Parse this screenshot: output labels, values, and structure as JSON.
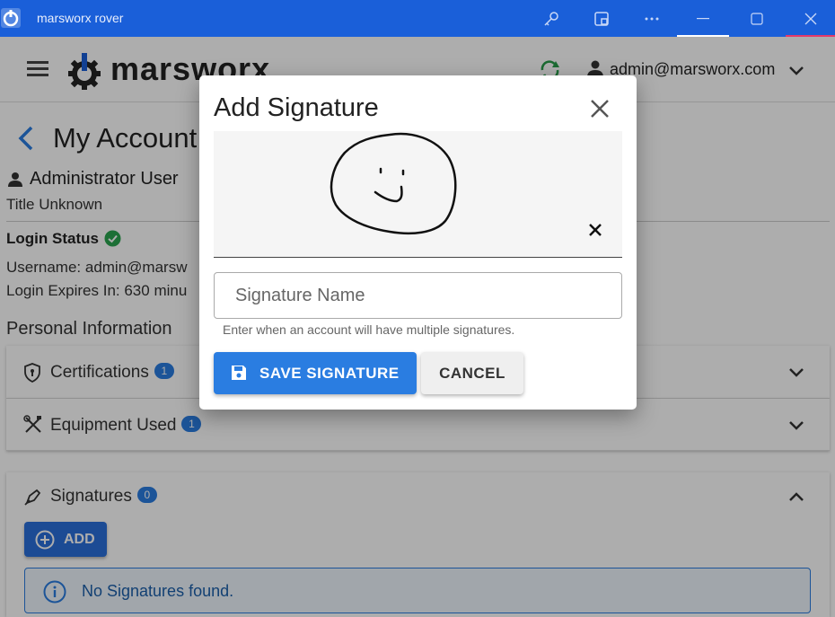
{
  "window": {
    "title": "marsworx rover",
    "accent_color": "#1a5fd9"
  },
  "appbar": {
    "brand": "marsworx",
    "user_email": "admin@marsworx.com"
  },
  "account": {
    "page_title": "My Account",
    "user_name": "Administrator User",
    "user_title": "Title Unknown",
    "login_status_label": "Login Status",
    "username_line": "Username: admin@marsw",
    "expires_line": "Login Expires In: 630 minu",
    "personal_heading": "Personal Information"
  },
  "panels": {
    "certifications": {
      "label": "Certifications",
      "count": "1"
    },
    "equipment": {
      "label": "Equipment Used",
      "count": "1"
    },
    "signatures": {
      "label": "Signatures",
      "count": "0"
    }
  },
  "signatures_section": {
    "add_label": "ADD",
    "empty_message": "No Signatures found."
  },
  "dialog": {
    "title": "Add Signature",
    "name_placeholder": "Signature Name",
    "name_value": "",
    "hint": "Enter when an account will have multiple signatures.",
    "save_label": "SAVE SIGNATURE",
    "cancel_label": "CANCEL",
    "primary_color": "#2a7de1"
  },
  "icons": {
    "window": [
      "app-logo-icon",
      "key-icon",
      "screen-cast-icon",
      "more-icon",
      "minimize-icon",
      "maximize-icon",
      "close-icon"
    ],
    "appbar": [
      "menu-icon",
      "brand-gear-icon",
      "sync-icon",
      "account-icon",
      "chevron-down-icon"
    ],
    "dialog": [
      "close-icon",
      "clear-icon",
      "save-icon"
    ]
  }
}
